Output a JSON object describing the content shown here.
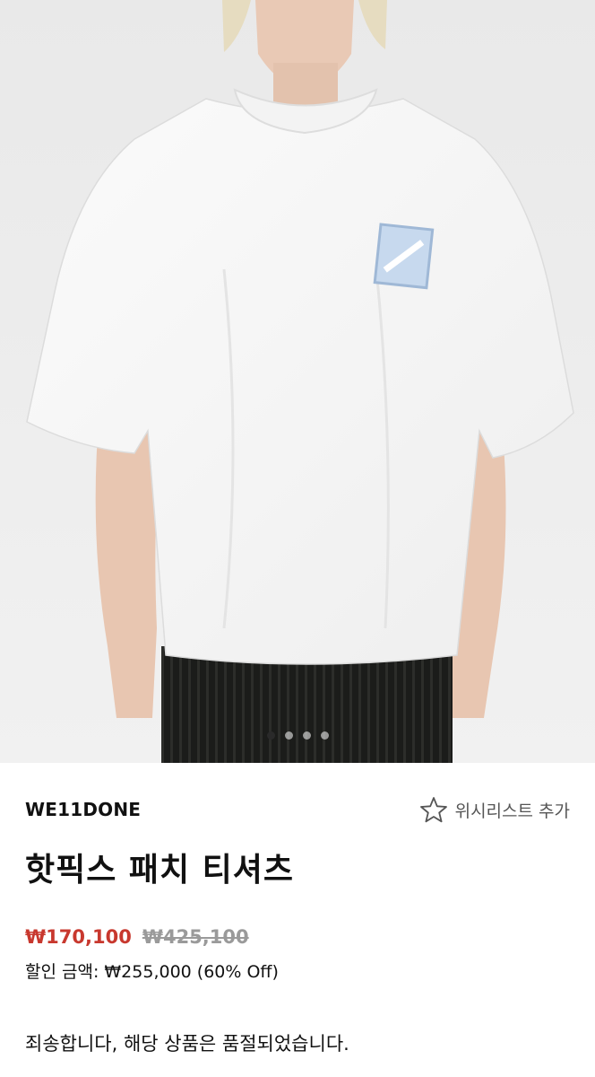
{
  "gallery": {
    "image_alt": "White oversized t-shirt with blue patch",
    "dot_count": 4,
    "active_dot": 0
  },
  "product": {
    "brand": "WE11DONE",
    "wishlist_label": "위시리스트 추가",
    "title": "핫픽스 패치 티셔츠",
    "sale_price": "₩170,100",
    "original_price": "₩425,100",
    "discount_text": "할인 금액: ₩255,000 (60% Off)",
    "soldout_message": "죄송합니다, 해당 상품은 품절되었습니다."
  },
  "colors": {
    "sale": "#c8382e",
    "strike": "#9a9a9a"
  }
}
